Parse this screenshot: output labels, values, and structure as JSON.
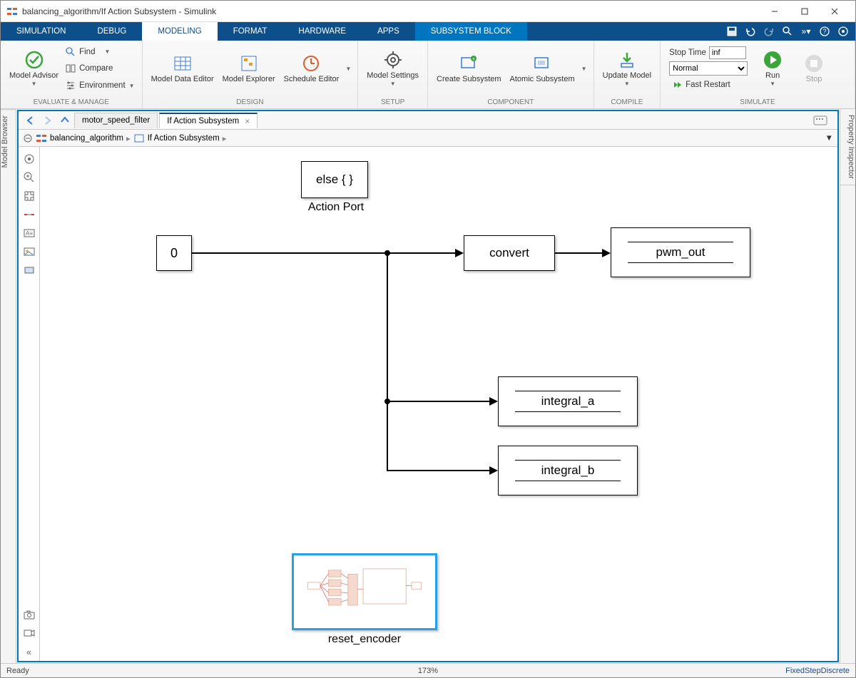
{
  "window": {
    "title": "balancing_algorithm/If Action Subsystem - Simulink"
  },
  "ribbon_tabs": {
    "simulation": "SIMULATION",
    "debug": "DEBUG",
    "modeling": "MODELING",
    "format": "FORMAT",
    "hardware": "HARDWARE",
    "apps": "APPS",
    "subsystem_block": "SUBSYSTEM BLOCK"
  },
  "ribbon": {
    "evaluate_manage": {
      "label": "EVALUATE & MANAGE",
      "model_advisor": "Model Advisor",
      "find": "Find",
      "compare": "Compare",
      "environment": "Environment"
    },
    "design": {
      "label": "DESIGN",
      "model_data_editor": "Model Data Editor",
      "model_explorer": "Model Explorer",
      "schedule_editor": "Schedule Editor"
    },
    "setup": {
      "label": "SETUP",
      "model_settings": "Model Settings"
    },
    "component": {
      "label": "COMPONENT",
      "create_subsystem": "Create Subsystem",
      "atomic_subsystem": "Atomic Subsystem"
    },
    "compile": {
      "label": "COMPILE",
      "update_model": "Update Model"
    },
    "simulate": {
      "label": "SIMULATE",
      "stop_time_label": "Stop Time",
      "stop_time_value": "inf",
      "mode": "Normal",
      "fast_restart": "Fast Restart",
      "run": "Run",
      "stop": "Stop"
    }
  },
  "doc_tabs": {
    "tab1": "motor_speed_filter",
    "tab2": "If Action Subsystem"
  },
  "breadcrumb": {
    "root": "balancing_algorithm",
    "child": "If Action Subsystem"
  },
  "panels": {
    "model_browser": "Model Browser",
    "property_inspector": "Property Inspector"
  },
  "blocks": {
    "action_port": "else { }",
    "action_port_label": "Action Port",
    "constant": "0",
    "convert": "convert",
    "pwm_out": "pwm_out",
    "integral_a": "integral_a",
    "integral_b": "integral_b",
    "reset_encoder": "reset_encoder"
  },
  "status": {
    "ready": "Ready",
    "zoom": "173%",
    "solver": "FixedStepDiscrete"
  }
}
